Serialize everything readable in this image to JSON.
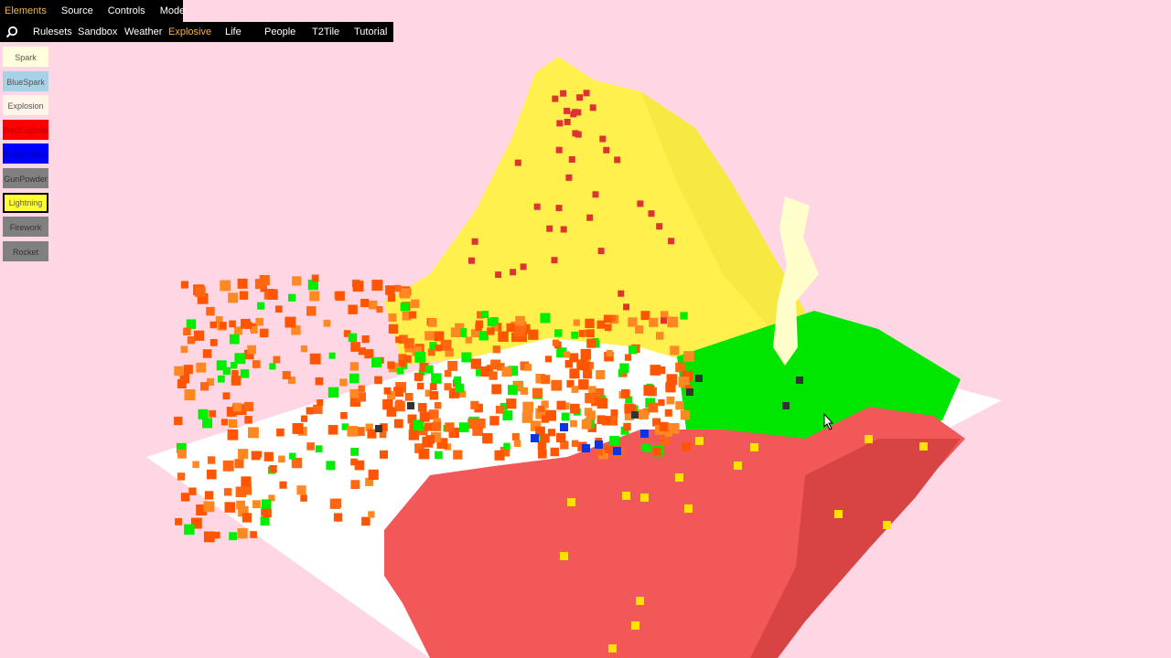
{
  "menu": {
    "items": [
      {
        "label": "Elements",
        "active": true
      },
      {
        "label": "Source",
        "active": false
      },
      {
        "label": "Controls",
        "active": false
      },
      {
        "label": "Mode",
        "active": false
      }
    ]
  },
  "tabs": {
    "search_icon": "search-icon",
    "items": [
      {
        "label": "Rulesets",
        "active": false
      },
      {
        "label": "Sandbox",
        "active": false
      },
      {
        "label": "Weather",
        "active": false
      },
      {
        "label": "Explosive",
        "active": true
      },
      {
        "label": "Life",
        "active": false
      },
      {
        "label": "People",
        "active": false
      },
      {
        "label": "T2Tile",
        "active": false
      },
      {
        "label": "Tutorial",
        "active": false
      }
    ]
  },
  "palette": {
    "items": [
      {
        "label": "Spark",
        "bg": "#ffffdd",
        "fg": "#555555",
        "selected": false
      },
      {
        "label": "BlueSpark",
        "bg": "#a7d1e4",
        "fg": "#555555",
        "selected": false
      },
      {
        "label": "Explosion",
        "bg": "#fff4e8",
        "fg": "#555555",
        "selected": false
      },
      {
        "label": "RedExplosion",
        "bg": "#ff0000",
        "fg": "#aa0000",
        "selected": false
      },
      {
        "label": "BlueExplosion",
        "bg": "#0000ff",
        "fg": "#0000aa",
        "selected": false
      },
      {
        "label": "GunPowder",
        "bg": "#808080",
        "fg": "#333333",
        "selected": false
      },
      {
        "label": "Lightning",
        "bg": "#ffff33",
        "fg": "#555555",
        "selected": true
      },
      {
        "label": "Firework",
        "bg": "#808080",
        "fg": "#333333",
        "selected": false
      },
      {
        "label": "Rocket",
        "bg": "#808080",
        "fg": "#333333",
        "selected": false
      }
    ]
  },
  "scene": {
    "colors": {
      "background": "#ffd6e4",
      "floor": "#ffffff",
      "mountain": "#ffff55",
      "lava": "#f25757",
      "grass": "#00ee00",
      "fire": "#ff5500",
      "fire_light": "#ff8822",
      "water": "#0022dd",
      "dark": "#333333",
      "spark": "#ffe100",
      "ember": "#dd3333"
    }
  }
}
